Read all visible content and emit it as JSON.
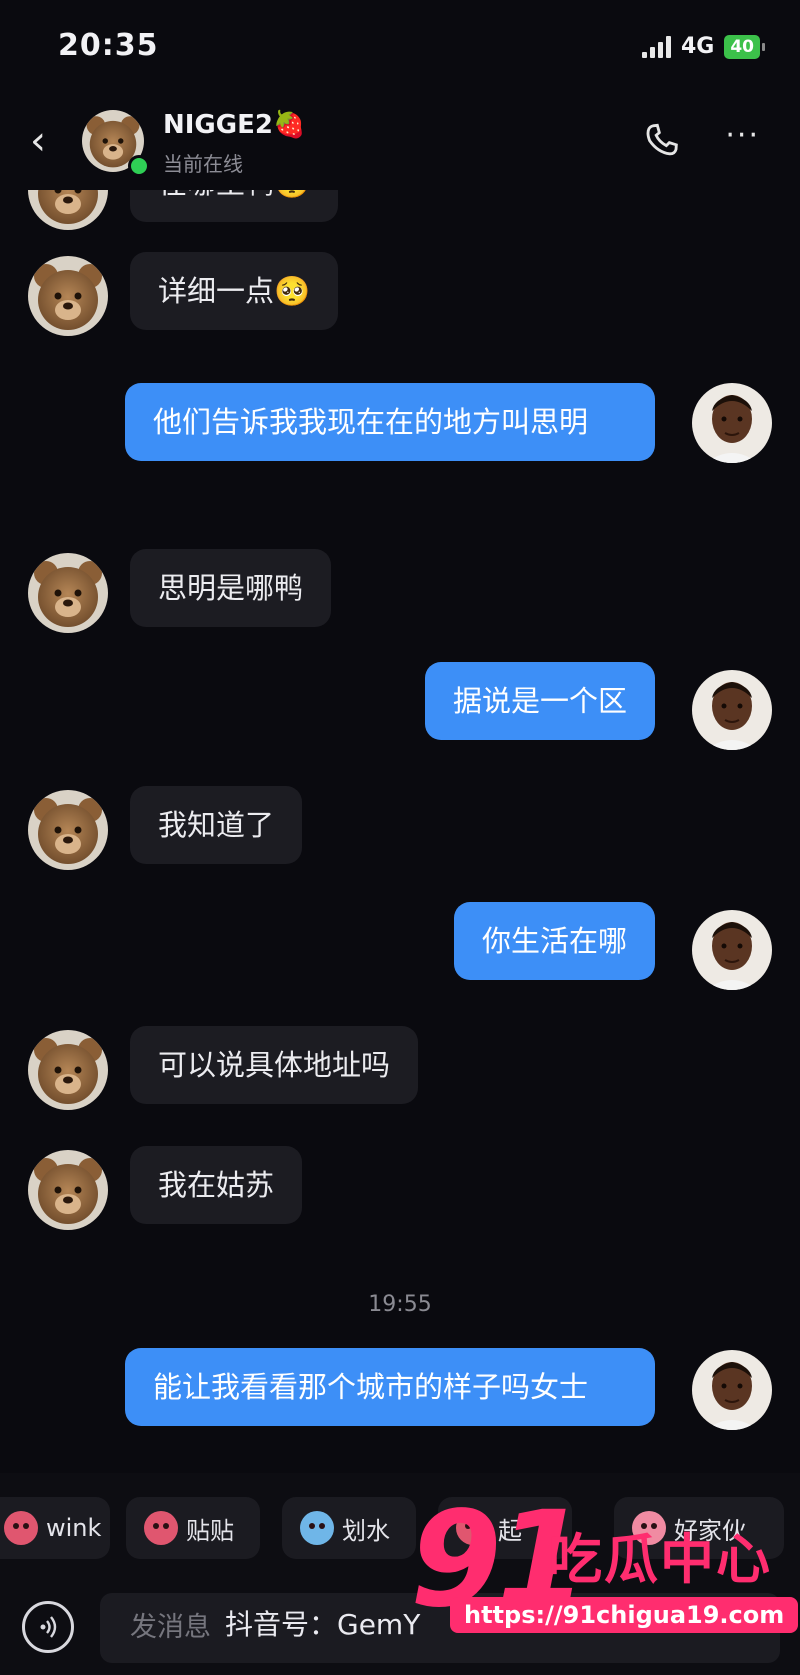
{
  "status_bar": {
    "time": "20:35",
    "network": "4G",
    "battery": "40"
  },
  "header": {
    "name": "NIGGE2🍓",
    "status": "当前在线"
  },
  "messages": [
    {
      "text": "在哪里鸭🥺"
    },
    {
      "text": "详细一点🥺"
    },
    {
      "text": "他们告诉我我现在在的地方叫思明"
    },
    {
      "text": "思明是哪鸭"
    },
    {
      "text": "据说是一个区"
    },
    {
      "text": "我知道了"
    },
    {
      "text": "你生活在哪"
    },
    {
      "text": "可以说具体地址吗"
    },
    {
      "text": "我在姑苏"
    },
    {
      "text": "能让我看看那个城市的样子吗女士"
    }
  ],
  "timestamp": "19:55",
  "quick_replies": [
    {
      "label": "wink"
    },
    {
      "label": "贴贴"
    },
    {
      "label": "划水"
    },
    {
      "label": "起"
    },
    {
      "label": "好家伙"
    }
  ],
  "input": {
    "placeholder": "发消息"
  },
  "overlay": {
    "douyin": "抖音号：GemY",
    "brand_number": "91",
    "brand_name": "吃瓜中心",
    "url": "https://91chigua19.com"
  },
  "colors": {
    "outgoing": "#3d8ff7",
    "incoming": "#1c1c22",
    "background": "#0a0a0f",
    "watermark": "#ff2d6f"
  }
}
